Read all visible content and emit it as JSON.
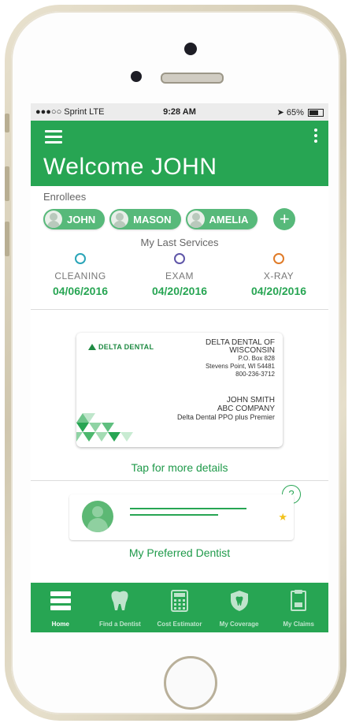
{
  "status_bar": {
    "carrier": "●●●○○ Sprint  LTE",
    "time": "9:28 AM",
    "battery": "65%"
  },
  "header": {
    "title": "Welcome JOHN"
  },
  "enrollees": {
    "label": "Enrollees",
    "members": [
      "JOHN",
      "MASON",
      "AMELIA"
    ],
    "add_label": "+"
  },
  "last_services": {
    "label": "My Last Services",
    "items": [
      {
        "name": "CLEANING",
        "date": "04/06/2016",
        "color": "#2aa5b8"
      },
      {
        "name": "EXAM",
        "date": "04/20/2016",
        "color": "#5f56a8"
      },
      {
        "name": "X-RAY",
        "date": "04/20/2016",
        "color": "#e07b28"
      }
    ]
  },
  "card": {
    "logo": "DELTA DENTAL",
    "org_line1": "DELTA DENTAL OF",
    "org_line2": "WISCONSIN",
    "po_box": "P.O. Box  828",
    "city": "Stevens Point, WI 54481",
    "phone": "800-236-3712",
    "member_name": "JOHN SMITH",
    "company": "ABC COMPANY",
    "plan": "Delta Dental PPO plus Premier",
    "tap_label": "Tap for more details"
  },
  "dentist": {
    "help": "?",
    "label": "My Preferred Dentist"
  },
  "tabs": [
    "Home",
    "Find a Dentist",
    "Cost Estimator",
    "My Coverage",
    "My Claims"
  ],
  "colors": {
    "brand_green": "#27a553"
  }
}
